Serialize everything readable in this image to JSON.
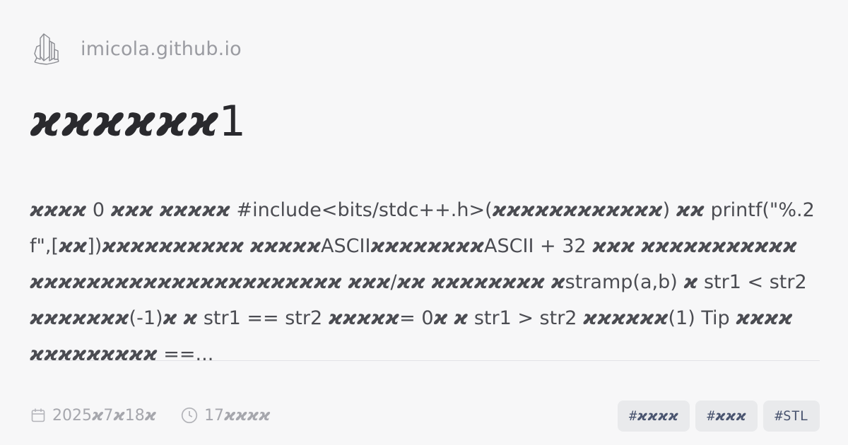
{
  "site": {
    "logo_icon": "crystal-cluster-icon",
    "name": "imicola.github.io"
  },
  "post": {
    "title": "𝟆𝟆𝟆𝟆𝟆𝟆1",
    "excerpt": "𝟆𝟆𝟆𝟆 0 𝟆𝟆𝟆 𝟆𝟆𝟆𝟆𝟆 #include<bits/stdc++.h>(𝟆𝟆𝟆𝟆𝟆𝟆𝟆𝟆𝟆𝟆𝟆𝟆) 𝟆𝟆 printf(\"%.2f\",[𝟆𝟆])𝟆𝟆𝟆𝟆𝟆𝟆𝟆𝟆𝟆𝟆 𝟆𝟆𝟆𝟆𝟆ASCII𝟆𝟆𝟆𝟆𝟆𝟆𝟆𝟆ASCII + 32 𝟆𝟆𝟆 𝟆𝟆𝟆𝟆𝟆𝟆𝟆𝟆𝟆𝟆𝟆𝟆𝟆𝟆𝟆𝟆𝟆𝟆𝟆𝟆𝟆𝟆𝟆𝟆𝟆𝟆𝟆𝟆𝟆𝟆𝟆𝟆𝟆 𝟆𝟆𝟆/𝟆𝟆 𝟆𝟆𝟆𝟆𝟆𝟆𝟆𝟆 𝟆stramp(a,b) 𝟆 str1 < str2 𝟆𝟆𝟆𝟆𝟆𝟆𝟆(-1)𝟆 𝟆 str1 == str2 𝟆𝟆𝟆𝟆𝟆= 0𝟆 𝟆 str1 > str2 𝟆𝟆𝟆𝟆𝟆𝟆(1)     Tip 𝟆𝟆𝟆𝟆𝟆𝟆𝟆𝟆𝟆𝟆𝟆𝟆𝟆 ==...",
    "date": "2025𝟆7𝟆18𝟆",
    "read_time": "17𝟆𝟆𝟆𝟆",
    "tags": [
      "#𝟆𝟆𝟆𝟆",
      "#𝟆𝟆𝟆",
      "#STL"
    ]
  },
  "icons": {
    "date": "calendar-icon",
    "read_time": "clock-icon"
  },
  "colors": {
    "background": "#f7f7f8",
    "title": "#2a2a2e",
    "text": "#4b4c52",
    "muted": "#a6a7ad",
    "tag_bg": "#e9eaec",
    "tag_text": "#4a5570"
  }
}
